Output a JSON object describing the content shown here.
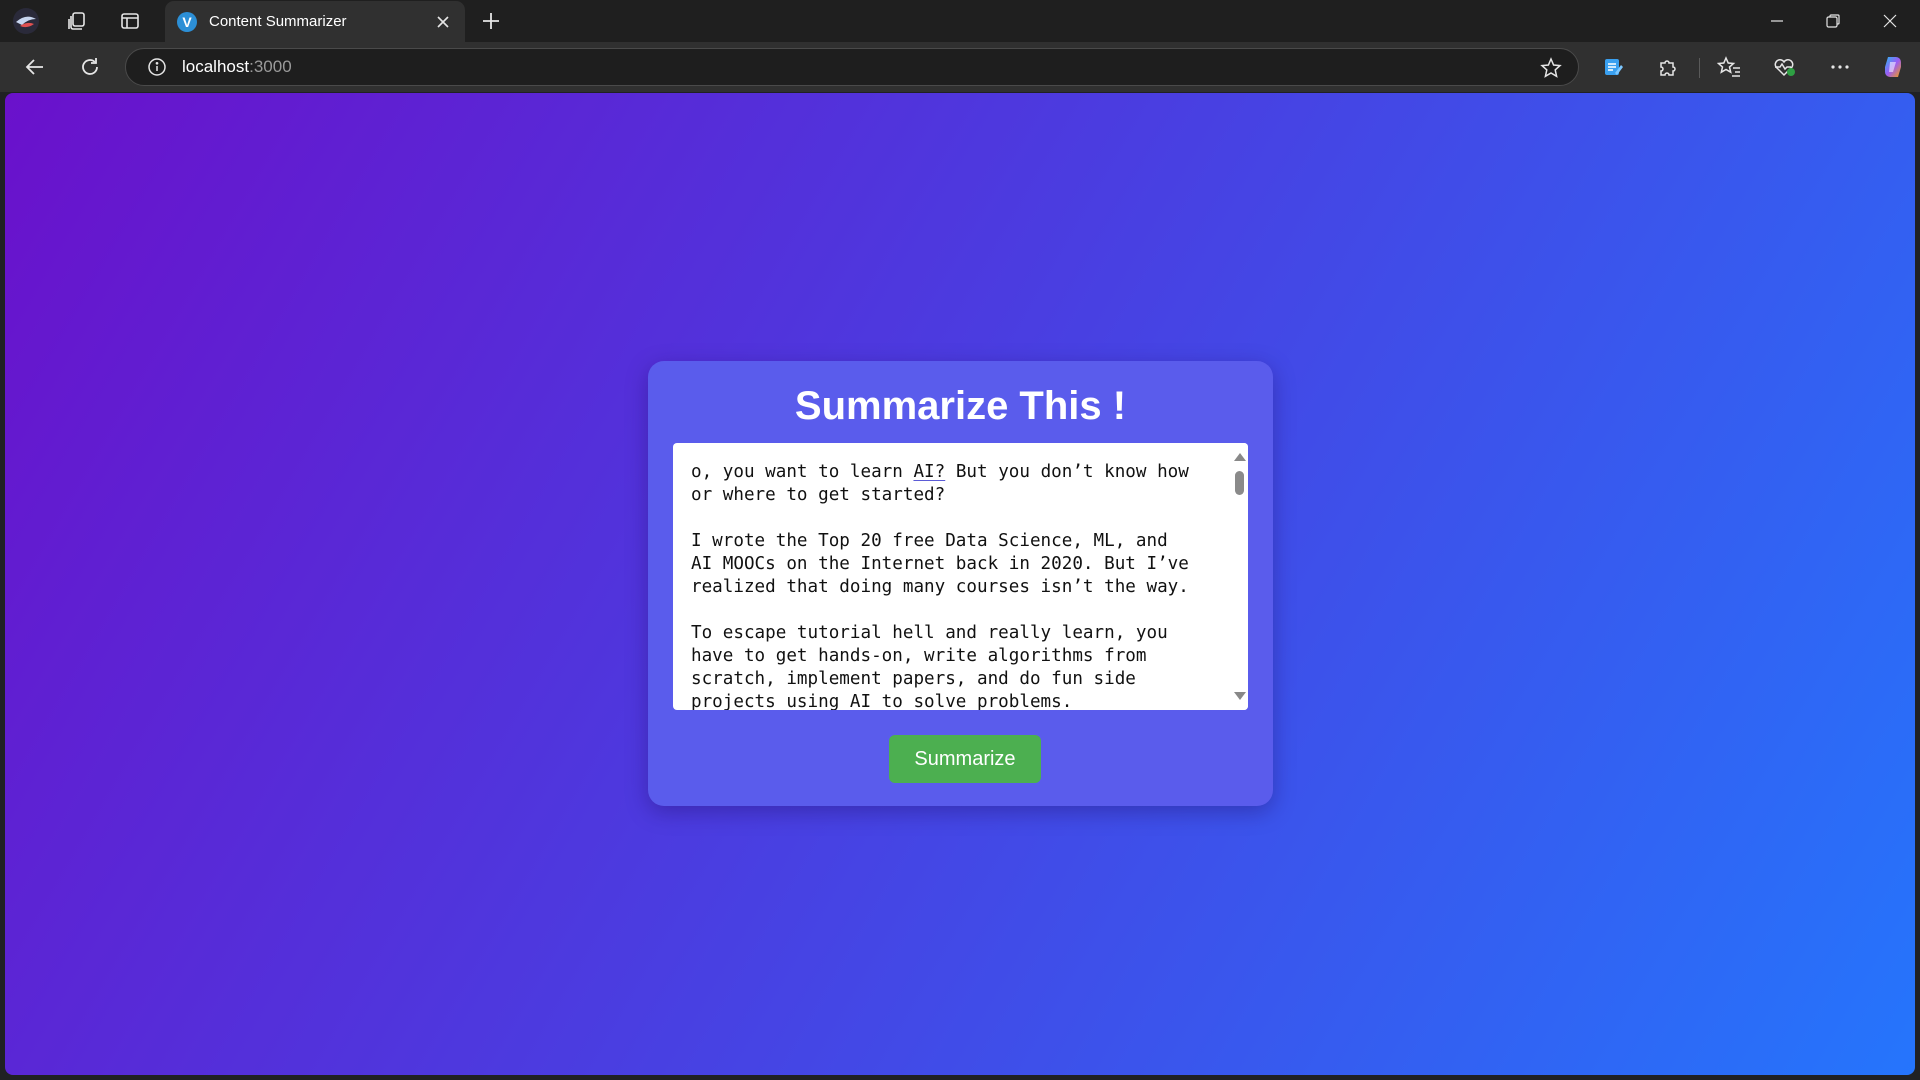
{
  "browser": {
    "tab": {
      "favicon_letter": "V",
      "title": "Content Summarizer"
    },
    "url": {
      "host": "localhost",
      "port": ":3000"
    },
    "icons": {
      "profile": "profile-avatar-icon",
      "workspaces": "workspaces-icon",
      "vertical_tabs": "vertical-tabs-icon",
      "new_tab": "plus-icon",
      "back": "back-arrow-icon",
      "refresh": "refresh-icon",
      "site_info": "info-icon",
      "favorite": "star-icon",
      "notes": "notes-icon",
      "extensions": "puzzle-icon",
      "favorites": "favorites-icon",
      "health": "heart-pulse-icon",
      "more": "more-icon",
      "copilot": "copilot-icon"
    }
  },
  "colors": {
    "gradient_start": "#6a11cb",
    "gradient_end": "#2575fc",
    "card": "#5a5cec",
    "button": "#4caf50"
  },
  "app": {
    "title": "Summarize This !",
    "textarea": {
      "line1_pre": "o, you want to learn ",
      "line1_link": "AI?",
      "line1_post": " But you don’t know how\nor where to get started?\n\nI wrote the Top 20 free Data Science, ML, and\nAI MOOCs on the Internet back in 2020. But I’ve\nrealized that doing many courses isn’t the way.\n\nTo escape tutorial hell and really learn, you\nhave to get hands-on, write algorithms from\nscratch, implement papers, and do fun side\nprojects using AI to solve problems."
    },
    "button_label": "Summarize"
  }
}
